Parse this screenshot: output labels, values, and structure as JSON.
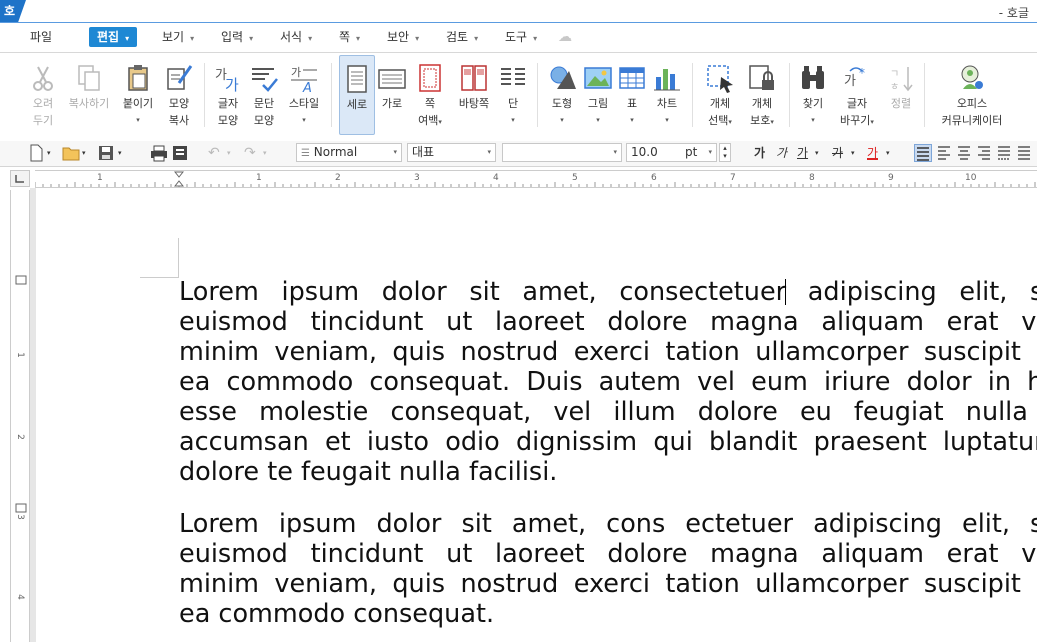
{
  "app": {
    "logo": "호",
    "title": "- 호글"
  },
  "menu": {
    "items": [
      {
        "label": "파일",
        "dd": false
      },
      {
        "label": "편집",
        "dd": true,
        "active": true
      },
      {
        "label": "보기",
        "dd": true
      },
      {
        "label": "입력",
        "dd": true
      },
      {
        "label": "서식",
        "dd": true
      },
      {
        "label": "쪽",
        "dd": true
      },
      {
        "label": "보안",
        "dd": true
      },
      {
        "label": "검토",
        "dd": true
      },
      {
        "label": "도구",
        "dd": true
      }
    ]
  },
  "ribbon": {
    "cut": [
      "오려",
      "두기"
    ],
    "copy": [
      "복사하기"
    ],
    "paste": [
      "붙이기"
    ],
    "format_copy": [
      "모양",
      "복사"
    ],
    "char_shape": [
      "글자",
      "모양"
    ],
    "para_shape": [
      "문단",
      "모양"
    ],
    "style": [
      "스타일"
    ],
    "portrait": [
      "세로"
    ],
    "landscape": [
      "가로"
    ],
    "page_margin": [
      "쪽",
      "여백"
    ],
    "background": [
      "바탕쪽"
    ],
    "column": [
      "단"
    ],
    "shape": [
      "도형"
    ],
    "picture": [
      "그림"
    ],
    "table": [
      "표"
    ],
    "chart": [
      "차트"
    ],
    "obj_select": [
      "개체",
      "선택"
    ],
    "obj_protect": [
      "개체",
      "보호"
    ],
    "find": [
      "찾기"
    ],
    "replace": [
      "글자",
      "바꾸기"
    ],
    "arrange": [
      "정렬"
    ],
    "navigator": [
      "오피스",
      "커뮤니케이터"
    ]
  },
  "format": {
    "style_value": "Normal",
    "font_lang_value": "대표",
    "font_name_value": "",
    "font_size_value": "10.0",
    "font_unit": "pt",
    "bold": "가",
    "italic": "가",
    "underline": "가",
    "strike": "가",
    "color": "가"
  },
  "ruler": {
    "marks": [
      "1",
      "1",
      "2",
      "3",
      "4",
      "5",
      "6",
      "7",
      "8",
      "9",
      "10"
    ]
  },
  "vruler": {
    "marks": [
      "1",
      "1",
      "2",
      "3",
      "4"
    ]
  },
  "document": {
    "para1": [
      "Lorem ipsum dolor sit amet, consectetuer",
      " adipiscing elit, se",
      "euismod tincidunt ut laoreet dolore magna aliquam erat vol",
      "minim veniam, quis nostrud exerci tation ullamcorper suscipit lo",
      "ea commodo consequat. Duis autem vel eum iriure dolor in he",
      "esse molestie consequat, vel illum dolore eu feugiat nulla f",
      "accumsan et iusto odio dignissim qui blandit praesent luptatum",
      "dolore te feugait nulla facilisi."
    ],
    "para2": [
      "Lorem ipsum dolor sit amet, cons ectetuer adipiscing elit, se",
      "euismod tincidunt ut laoreet dolore magna aliquam erat vol",
      "minim veniam, quis nostrud exerci tation ullamcorper suscipit lo",
      "ea commodo consequat."
    ]
  },
  "colors": {
    "accent": "#1e88d4",
    "logo": "#1e73c8"
  }
}
